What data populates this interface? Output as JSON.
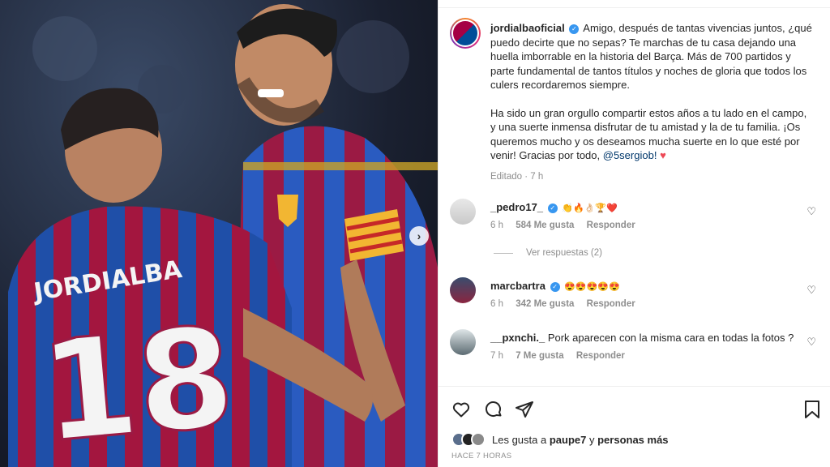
{
  "post": {
    "username": "jordialbaoficial",
    "caption_p1": "Amigo, después de tantas vivencias juntos, ¿qué puedo decirte que no sepas? Te marchas de tu casa dejando una huella imborrable en la historia del Barça. Más de 700 partidos y parte fundamental de tantos títulos y noches de gloria que todos los culers recordaremos siempre.",
    "caption_p2": "Ha sido un gran orgullo compartir estos años a tu lado en el campo, y una suerte inmensa disfrutar de tu amistad y la de tu familia. ¡Os queremos mucho y os deseamos mucha suerte en lo que esté por venir! Gracias por todo,",
    "mention": "@5sergiob!",
    "meta": "Editado · 7 h"
  },
  "photo": {
    "jersey_name": "JORDIALBA",
    "jersey_number": "18"
  },
  "comments": [
    {
      "username": "_pedro17_",
      "text": "👏🔥👌🏻🏆❤️",
      "time": "6 h",
      "likes": "584 Me gusta",
      "reply": "Responder",
      "replies": "Ver respuestas (2)"
    },
    {
      "username": "marcbartra",
      "text": "😍😍😍😍😍",
      "time": "6 h",
      "likes": "342 Me gusta",
      "reply": "Responder"
    },
    {
      "username": "__pxnchi._",
      "text": "Pork aparecen con la misma cara en todas la fotos ?",
      "time": "7 h",
      "likes": "7 Me gusta",
      "reply": "Responder"
    }
  ],
  "likes": {
    "prefix": "Les gusta a",
    "user": "paupe7",
    "mid": "y",
    "others": "personas más"
  },
  "timestamp": "HACE 7 HORAS",
  "colors": {
    "verified": "#3897f0",
    "mention": "#00376b",
    "heart": "#ed4956",
    "barca_blue": "#004d98",
    "barca_red": "#a50044"
  }
}
